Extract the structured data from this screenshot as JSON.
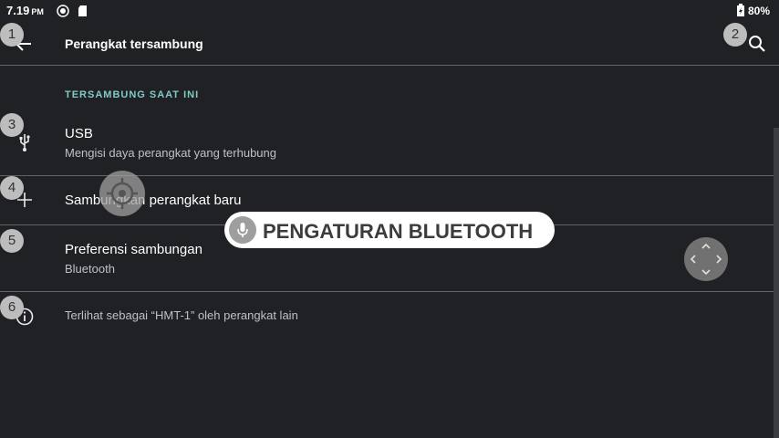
{
  "status_bar": {
    "time": "7.19",
    "ampm": "PM",
    "battery": "80%",
    "icons": [
      "notification-circle-icon",
      "sd-card-icon",
      "battery-charging-icon"
    ]
  },
  "app_bar": {
    "title": "Perangkat tersambung",
    "back_icon": "arrow-back-icon",
    "search_icon": "search-icon"
  },
  "section": {
    "header": "TERSAMBUNG SAAT INI"
  },
  "rows": [
    {
      "title": "USB",
      "subtitle": "Mengisi daya perangkat yang terhubung",
      "icon": "usb-icon"
    },
    {
      "title": "Sambungkan perangkat baru",
      "icon": "plus-icon"
    },
    {
      "title": "Preferensi sambungan",
      "subtitle": "Bluetooth",
      "icon": ""
    },
    {
      "title": "Terlihat sebagai “HMT-1” oleh perangkat lain",
      "icon": "info-icon"
    }
  ],
  "badges": [
    "1",
    "2",
    "3",
    "4",
    "5",
    "6"
  ],
  "overlays": {
    "voice_command": "PENGATURAN BLUETOOTH",
    "mic_icon": "microphone-icon",
    "target_icon": "crosshair-icon",
    "dpad_icon": "dpad-icon"
  },
  "colors": {
    "background": "#202124",
    "accent": "#80cbc4",
    "divider": "#5f6368",
    "badge": "#bdbdbd"
  }
}
